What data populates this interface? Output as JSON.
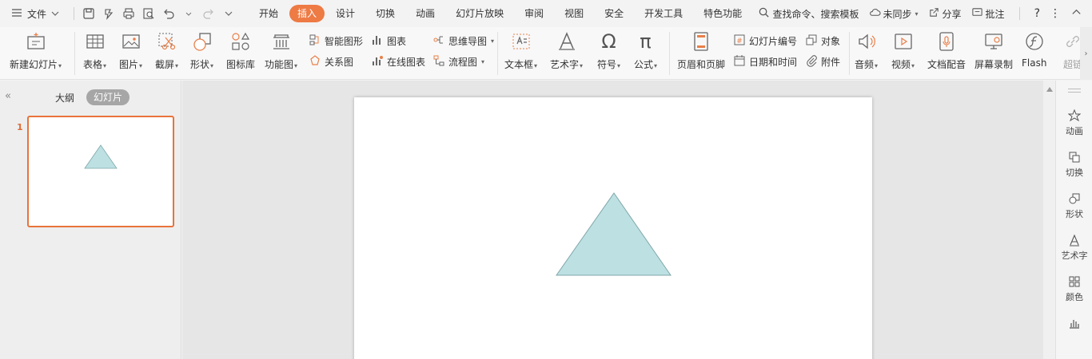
{
  "menubar": {
    "file_label": "文件",
    "tabs": [
      {
        "label": "开始",
        "active": false
      },
      {
        "label": "插入",
        "active": true
      },
      {
        "label": "设计",
        "active": false
      },
      {
        "label": "切换",
        "active": false
      },
      {
        "label": "动画",
        "active": false
      },
      {
        "label": "幻灯片放映",
        "active": false
      },
      {
        "label": "审阅",
        "active": false
      },
      {
        "label": "视图",
        "active": false
      },
      {
        "label": "安全",
        "active": false
      },
      {
        "label": "开发工具",
        "active": false
      },
      {
        "label": "特色功能",
        "active": false
      }
    ],
    "search_label": "查找命令、搜索模板",
    "sync_label": "未同步",
    "share_label": "分享",
    "comment_label": "批注",
    "help_label": "?",
    "accent_color": "#ee7a44"
  },
  "ribbon": {
    "new_slide": "新建幻灯片",
    "table": "表格",
    "picture": "图片",
    "screenshot": "截屏",
    "shape": "形状",
    "icon_lib": "图标库",
    "function_chart": "功能图",
    "smart_art": "智能图形",
    "chart": "图表",
    "relation": "关系图",
    "online_chart": "在线图表",
    "mind_map": "思维导图",
    "flowchart": "流程图",
    "textbox": "文本框",
    "wordart": "艺术字",
    "symbol": "符号",
    "formula": "公式",
    "header_footer": "页眉和页脚",
    "slide_number": "幻灯片编号",
    "datetime": "日期和时间",
    "object": "对象",
    "attachment": "附件",
    "audio": "音频",
    "video": "视频",
    "doc_dubbing": "文档配音",
    "screen_record": "屏幕录制",
    "flash": "Flash",
    "hyperlink": "超链"
  },
  "leftpane": {
    "outline_tab": "大纲",
    "slides_tab": "幻灯片",
    "slide_number": "1"
  },
  "slide": {
    "shape": "triangle",
    "shape_fill": "#bde0e3",
    "shape_stroke": "#7fa7a9"
  },
  "rightpane": {
    "items": [
      {
        "label": "动画",
        "icon": "animation-icon"
      },
      {
        "label": "切换",
        "icon": "transition-icon"
      },
      {
        "label": "形状",
        "icon": "shape-icon"
      },
      {
        "label": "艺术字",
        "icon": "wordart-icon"
      },
      {
        "label": "颜色",
        "icon": "color-icon"
      }
    ]
  }
}
